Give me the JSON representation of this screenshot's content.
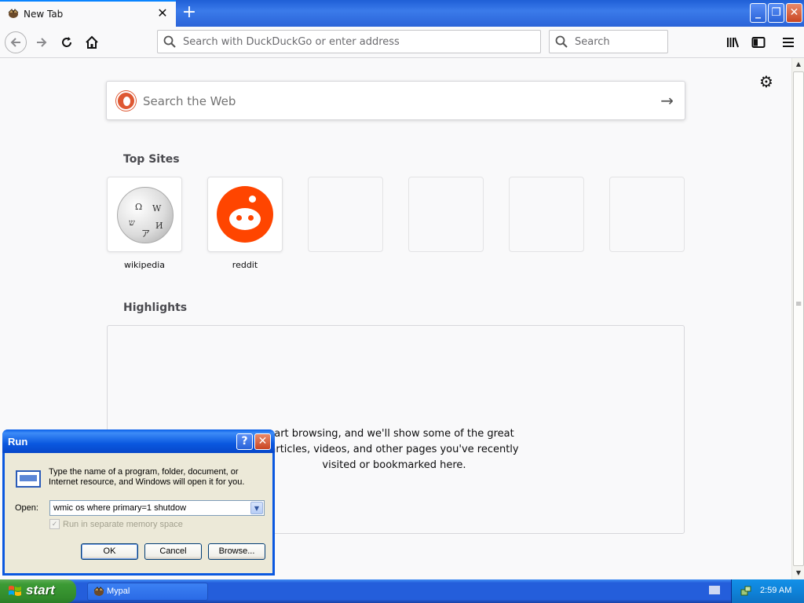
{
  "browser": {
    "tab_title": "New Tab",
    "new_tab_symbol": "+",
    "tab_close_symbol": "✕",
    "window_buttons": {
      "minimize": "_",
      "maximize": "❐",
      "close": "✕"
    }
  },
  "toolbar": {
    "address_placeholder": "Search with DuckDuckGo or enter address",
    "search_placeholder": "Search"
  },
  "newtab": {
    "web_search_placeholder": "Search the Web",
    "top_sites_title": "Top Sites",
    "top_sites": [
      {
        "label": "wikipedia"
      },
      {
        "label": "reddit"
      },
      {
        "label": ""
      },
      {
        "label": ""
      },
      {
        "label": ""
      },
      {
        "label": ""
      }
    ],
    "highlights_title": "Highlights",
    "highlights_message": "art browsing, and we'll show some of the great articles, videos, and other pages you've recently visited or bookmarked here."
  },
  "run_dialog": {
    "title": "Run",
    "help_symbol": "?",
    "close_symbol": "✕",
    "description": "Type the name of a program, folder, document, or Internet resource, and Windows will open it for you.",
    "open_label": "Open:",
    "open_value": "wmic os where primary=1 shutdow",
    "checkbox_label": "Run in separate memory space",
    "checkbox_checked": true,
    "checkbox_enabled": false,
    "ok_label": "OK",
    "cancel_label": "Cancel",
    "browse_label": "Browse..."
  },
  "taskbar": {
    "start_label": "start",
    "tasks": [
      {
        "label": "Mypal"
      }
    ],
    "clock": "2:59 AM"
  },
  "colors": {
    "taskbar_blue": "#245edb",
    "start_green": "#3c9b35",
    "reddit_orange": "#ff4500",
    "ddg_orange": "#de5833"
  }
}
